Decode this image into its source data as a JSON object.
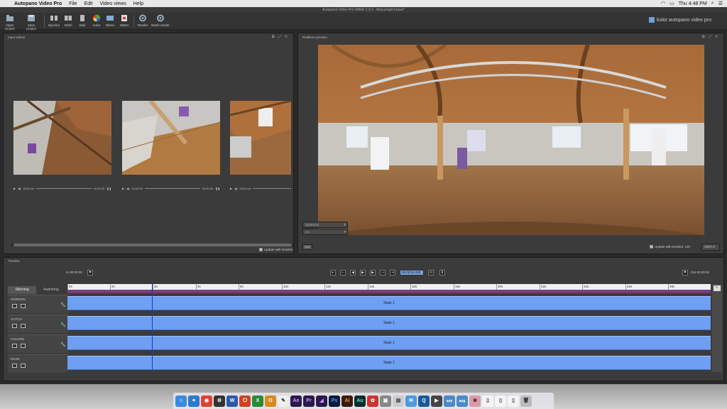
{
  "menubar": {
    "app_name": "Autopano Video Pro",
    "menus": [
      "File",
      "Edit",
      "Video views",
      "Help"
    ],
    "clock": "Thu 4:48 PM"
  },
  "window_title": "Autopano Video Pro 64bits 2.3.2 - blog project.kava*",
  "toolbar": {
    "buttons": [
      "Open project",
      "Save project",
      "Synchro",
      "Stitch",
      "Stab",
      "Color",
      "Blend",
      "States",
      "Render",
      "Batch render"
    ],
    "brand": "kolor autopano video pro"
  },
  "input_panel": {
    "title": "Input videos",
    "players": [
      {
        "time": "00:00:04",
        "end": "00:00:30"
      },
      {
        "time": "00:00:04",
        "end": "00:00:30"
      },
      {
        "time": "00:00:04",
        "end": ""
      }
    ],
    "update_label": "Update with timeline"
  },
  "preview_panel": {
    "title": "Realtime preview",
    "projection": "Spherical",
    "ratio": "2:1",
    "edit_label": "Edit",
    "update_label": "Update with timeline",
    "fov": "120",
    "zoom": "100%"
  },
  "timeline": {
    "title": "Timeline",
    "in_label": "In",
    "in_time": "00:00:00",
    "out_label": "Out",
    "out_time": "00:00:00",
    "current_time": "00:00:04.000",
    "tabs": [
      "Stitching",
      "Authoring"
    ],
    "ruler_ticks": [
      "0s",
      "2s",
      "4s",
      "6s",
      "8s",
      "10s",
      "12s",
      "14s",
      "16s",
      "18s",
      "20s",
      "22s",
      "24s",
      "26s",
      "28s"
    ],
    "tracks": [
      {
        "name": "HORIZON",
        "state": "State 1"
      },
      {
        "name": "STITCH",
        "state": "State 1"
      },
      {
        "name": "COLORS",
        "state": "State 1"
      },
      {
        "name": "MASK",
        "state": "State 1"
      }
    ]
  },
  "dock": {
    "apps": [
      "Finder",
      "Safari",
      "Chrome",
      "Steam",
      "Word",
      "Acrobat",
      "Excel",
      "Outlook",
      "TextEdit",
      "After Effects",
      "Premiere",
      "Media Encoder",
      "Photoshop",
      "Illustrator",
      "Audition",
      "DaVinci",
      "Image Capture",
      "Preview",
      "Mail",
      "QuickTime",
      "ScreenFlow",
      "Autopano Video",
      "Autopano Giga",
      "Photos",
      "Document",
      "Document",
      "Document",
      "Trash"
    ]
  }
}
